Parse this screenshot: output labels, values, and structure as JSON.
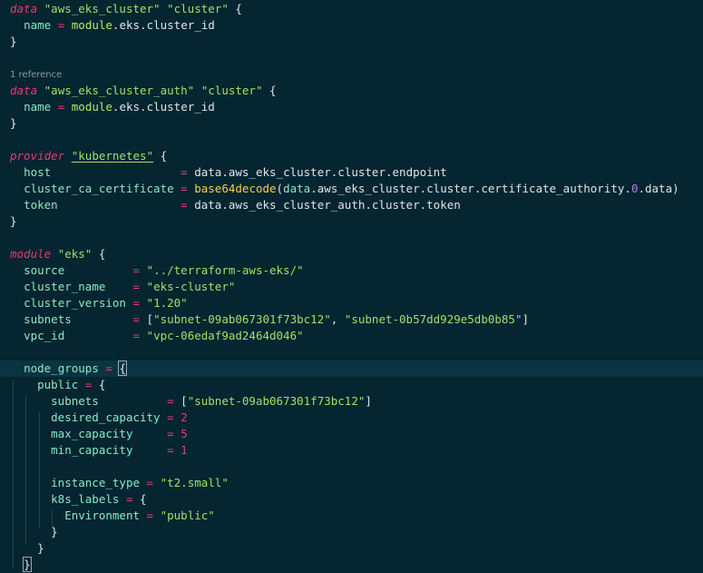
{
  "code": {
    "l1": {
      "kw": "data",
      "t1": "\"aws_eks_cluster\"",
      "t2": "\"cluster\"",
      "b": "{"
    },
    "l2": {
      "attr": "name",
      "eq": "=",
      "mod": "module",
      "d1": ".",
      "ref": "eks",
      "d2": ".",
      "ref2": "cluster_id"
    },
    "l3": {
      "b": "}"
    },
    "l5": {
      "lens": "1 reference"
    },
    "l6": {
      "kw": "data",
      "t1": "\"aws_eks_cluster_auth\"",
      "t2": "\"cluster\"",
      "b": "{"
    },
    "l7": {
      "attr": "name",
      "eq": "=",
      "mod": "module",
      "d1": ".",
      "ref": "eks",
      "d2": ".",
      "ref2": "cluster_id"
    },
    "l8": {
      "b": "}"
    },
    "l10": {
      "kw": "provider",
      "t1": "\"kubernetes\"",
      "b": "{"
    },
    "l11": {
      "attr": "host",
      "eq": "=",
      "p1": "data",
      "p2": "aws_eks_cluster",
      "p3": "cluster",
      "p4": "endpoint",
      "d": "."
    },
    "l12": {
      "attr": "cluster_ca_certificate",
      "eq": "=",
      "fn": "base64decode",
      "lp": "(",
      "p1": "data",
      "p2": "aws_eks_cluster",
      "p3": "cluster",
      "p4": "certificate_authority",
      "p5": "0",
      "p6": "data",
      "rp": ")",
      "d": "."
    },
    "l13": {
      "attr": "token",
      "eq": "=",
      "p1": "data",
      "p2": "aws_eks_cluster_auth",
      "p3": "cluster",
      "p4": "token",
      "d": "."
    },
    "l14": {
      "b": "}"
    },
    "l16": {
      "kw": "module",
      "t1": "\"eks\"",
      "b": "{"
    },
    "l17": {
      "attr": "source",
      "eq": "=",
      "v": "\"../terraform-aws-eks/\""
    },
    "l18": {
      "attr": "cluster_name",
      "eq": "=",
      "v": "\"eks-cluster\""
    },
    "l19": {
      "attr": "cluster_version",
      "eq": "=",
      "v": "\"1.20\""
    },
    "l20": {
      "attr": "subnets",
      "eq": "=",
      "lb": "[",
      "v1": "\"subnet-09ab067301f73bc12\"",
      "c": ",",
      "v2": "\"subnet-0b57dd929e5db0b85\"",
      "rb": "]"
    },
    "l21": {
      "attr": "vpc_id",
      "eq": "=",
      "v": "\"vpc-06edaf9ad2464d046\""
    },
    "l23": {
      "attr": "node_groups",
      "eq": "=",
      "b": "{"
    },
    "l24": {
      "attr": "public",
      "eq": "=",
      "b": "{"
    },
    "l25": {
      "attr": "subnets",
      "eq": "=",
      "lb": "[",
      "v1": "\"subnet-09ab067301f73bc12\"",
      "rb": "]"
    },
    "l26": {
      "attr": "desired_capacity",
      "eq": "=",
      "n": "2"
    },
    "l27": {
      "attr": "max_capacity",
      "eq": "=",
      "n": "5"
    },
    "l28": {
      "attr": "min_capacity",
      "eq": "=",
      "n": "1"
    },
    "l30": {
      "attr": "instance_type",
      "eq": "=",
      "v": "\"t2.small\""
    },
    "l31": {
      "attr": "k8s_labels",
      "eq": "=",
      "b": "{"
    },
    "l32": {
      "attr": "Environment",
      "eq": "=",
      "v": "\"public\""
    },
    "l33": {
      "b": "}"
    },
    "l34": {
      "b": "}"
    },
    "l35": {
      "b": "}"
    }
  },
  "colors": {
    "background": "#052530",
    "keyword": "#e03a74",
    "string": "#9ce469",
    "attribute": "#8be8c6",
    "function": "#f0d24a",
    "number": "#e03a74",
    "constant": "#b57be0"
  }
}
